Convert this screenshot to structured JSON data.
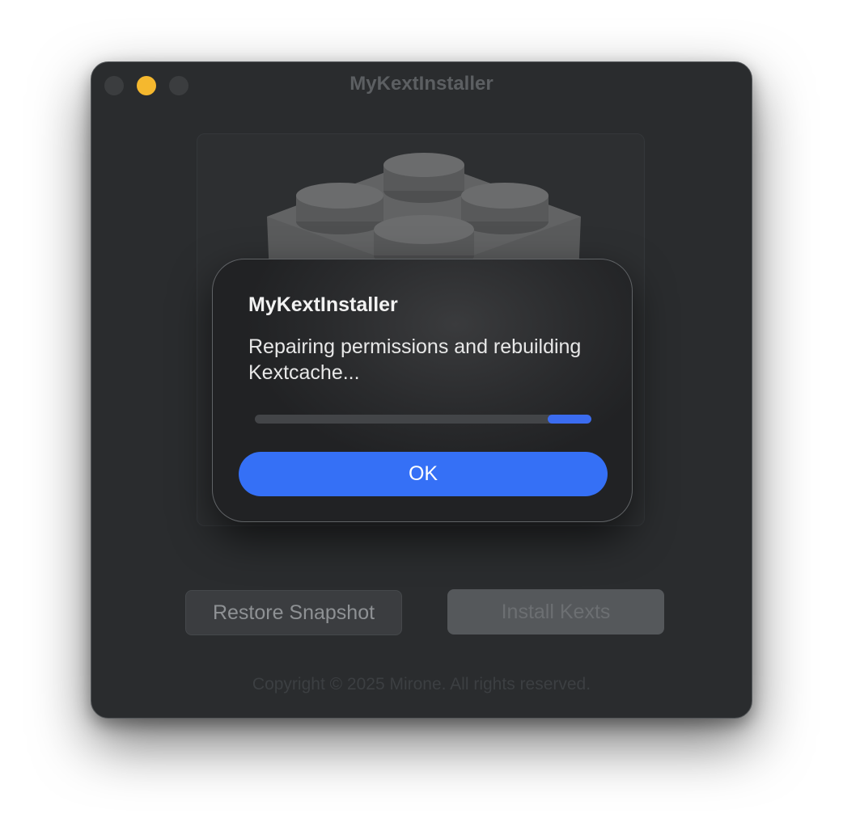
{
  "window": {
    "title": "MyKextInstaller",
    "traffic_lights": [
      {
        "name": "close",
        "color": "#3b3d3f"
      },
      {
        "name": "minimize",
        "color": "#f5b82e"
      },
      {
        "name": "zoom",
        "color": "#3b3d3f"
      }
    ]
  },
  "app_icon": {
    "name": "lego-brick-icon"
  },
  "buttons": {
    "restore_label": "Restore Snapshot",
    "install_label": "Install Kexts"
  },
  "footer": {
    "copyright": "Copyright © 2025 Mirone. All rights reserved."
  },
  "dialog": {
    "title": "MyKextInstaller",
    "message": "Repairing permissions and rebuilding Kextcache...",
    "progress": {
      "type": "indeterminate",
      "accent": "#3b6cf0"
    },
    "ok_label": "OK"
  },
  "colors": {
    "accent": "#3570f6",
    "window_bg": "#2a2c2e"
  }
}
